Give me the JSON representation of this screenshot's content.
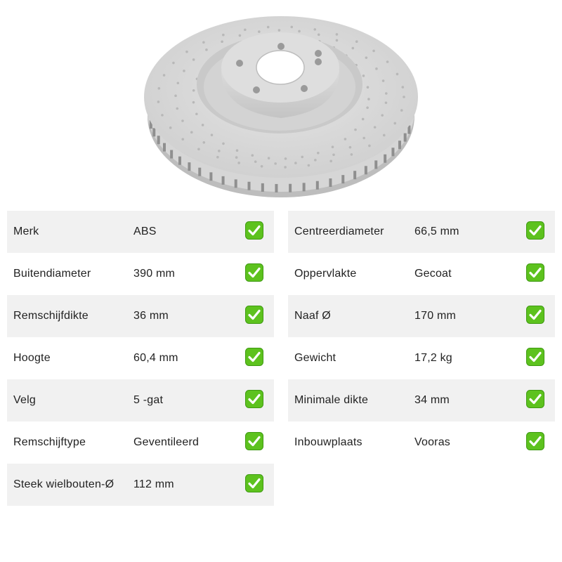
{
  "product": {
    "image_icon": "brake-disc-image"
  },
  "specs": {
    "left": [
      {
        "label": "Merk",
        "value": "ABS",
        "status_icon": "check-icon"
      },
      {
        "label": "Buitendiameter",
        "value": "390 mm",
        "status_icon": "check-icon"
      },
      {
        "label": "Remschijfdikte",
        "value": "36 mm",
        "status_icon": "check-icon"
      },
      {
        "label": "Hoogte",
        "value": "60,4 mm",
        "status_icon": "check-icon"
      },
      {
        "label": "Velg",
        "value": "5 -gat",
        "status_icon": "check-icon"
      },
      {
        "label": "Remschijftype",
        "value": "Geventileerd",
        "status_icon": "check-icon"
      },
      {
        "label": "Steek wielbouten-Ø",
        "value": "112 mm",
        "status_icon": "check-icon"
      }
    ],
    "right": [
      {
        "label": "Centreerdiameter",
        "value": "66,5 mm",
        "status_icon": "check-icon"
      },
      {
        "label": "Oppervlakte",
        "value": "Gecoat",
        "status_icon": "check-icon"
      },
      {
        "label": "Naaf Ø",
        "value": "170 mm",
        "status_icon": "check-icon"
      },
      {
        "label": "Gewicht",
        "value": "17,2 kg",
        "status_icon": "check-icon"
      },
      {
        "label": "Minimale dikte",
        "value": "34 mm",
        "status_icon": "check-icon"
      },
      {
        "label": "Inbouwplaats",
        "value": "Vooras",
        "status_icon": "check-icon"
      }
    ]
  },
  "colors": {
    "row_shade": "#f1f1f1",
    "check_green": "#5dc21e",
    "disc_gray": "#d9d9d9"
  }
}
